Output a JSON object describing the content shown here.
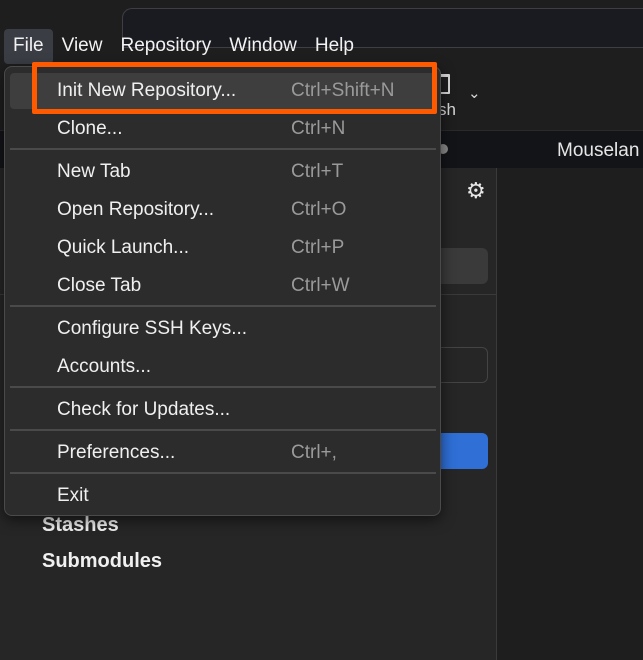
{
  "menubar": {
    "items": [
      {
        "label": "File"
      },
      {
        "label": "View"
      },
      {
        "label": "Repository"
      },
      {
        "label": "Window"
      },
      {
        "label": "Help"
      }
    ]
  },
  "toolbar": {
    "fragment_label": "sh"
  },
  "tabs": {
    "visible_tab": "Mouselan"
  },
  "sidebar": {
    "headings": [
      "Stashes",
      "Submodules"
    ]
  },
  "file_menu": {
    "items": [
      {
        "label": "Init New Repository...",
        "shortcut": "Ctrl+Shift+N"
      },
      {
        "label": "Clone...",
        "shortcut": "Ctrl+N"
      },
      {
        "label": "New Tab",
        "shortcut": "Ctrl+T"
      },
      {
        "label": "Open Repository...",
        "shortcut": "Ctrl+O"
      },
      {
        "label": "Quick Launch...",
        "shortcut": "Ctrl+P"
      },
      {
        "label": "Close Tab",
        "shortcut": "Ctrl+W"
      },
      {
        "label": "Configure SSH Keys...",
        "shortcut": ""
      },
      {
        "label": "Accounts...",
        "shortcut": ""
      },
      {
        "label": "Check for Updates...",
        "shortcut": ""
      },
      {
        "label": "Preferences...",
        "shortcut": "Ctrl+,"
      },
      {
        "label": "Exit",
        "shortcut": ""
      }
    ]
  },
  "colors": {
    "highlight_outline": "#ff5a00",
    "menu_background": "#2c2c2c",
    "accent_blue": "#2f6fd6"
  }
}
